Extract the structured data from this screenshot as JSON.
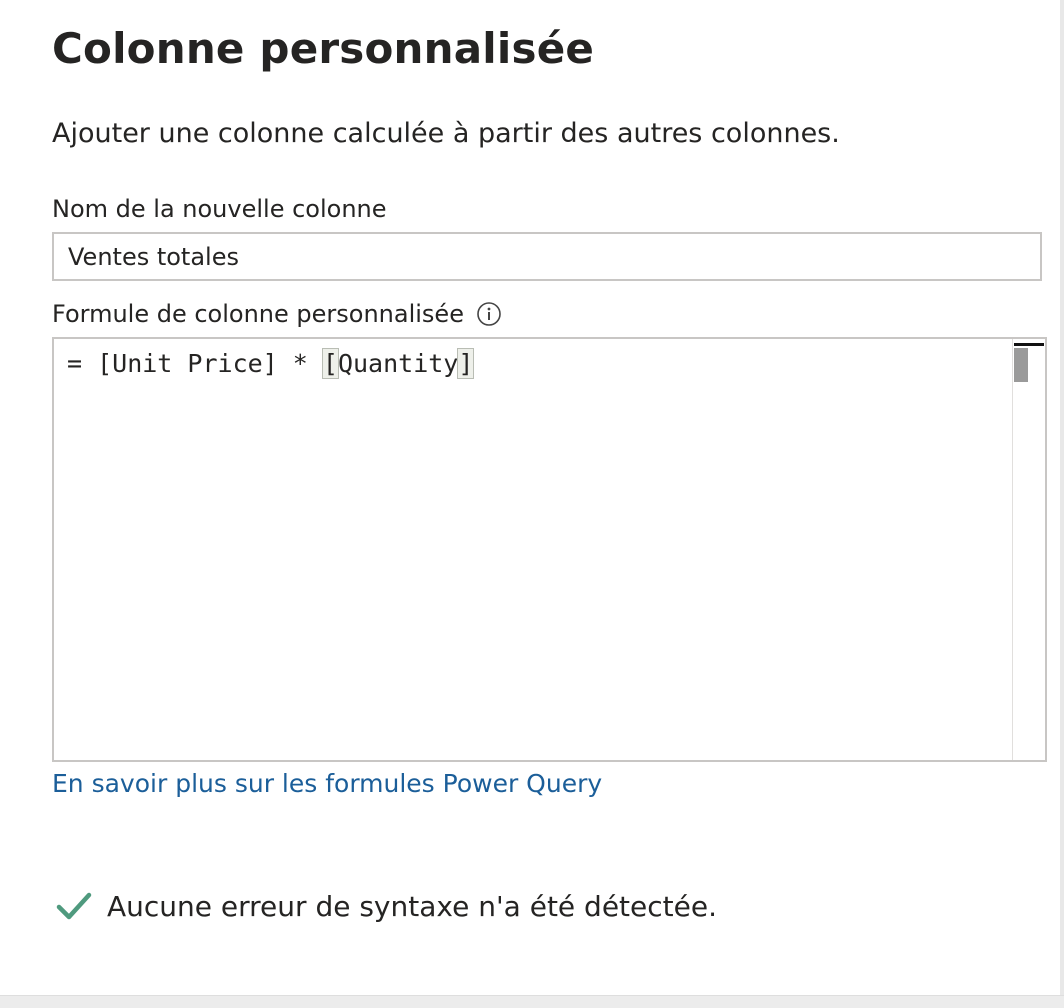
{
  "dialog": {
    "title": "Colonne personnalisée",
    "description": "Ajouter une colonne calculée à partir des autres colonnes."
  },
  "name_field": {
    "label": "Nom de la nouvelle colonne",
    "value": "Ventes totales"
  },
  "formula_field": {
    "label": "Formule de colonne personnalisée",
    "info_icon": "info-icon",
    "code": {
      "prefix": "= [Unit Price] * ",
      "open_bracket": "[",
      "identifier": "Quantity",
      "close_bracket": "]"
    }
  },
  "learn_more_link": "En savoir plus sur les formules Power Query",
  "status": {
    "icon": "checkmark-icon",
    "text": "Aucune erreur de syntaxe n'a été détectée.",
    "color": "#4f9a7e"
  },
  "colors": {
    "link": "#1b5e99",
    "text": "#252423",
    "border": "#c8c6c4"
  }
}
